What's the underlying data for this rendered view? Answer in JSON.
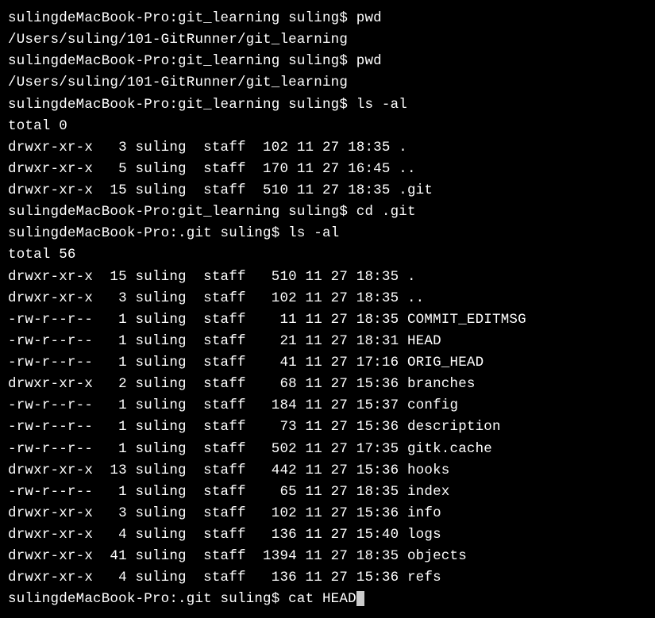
{
  "lines": [
    {
      "type": "prompt",
      "prompt": "sulingdeMacBook-Pro:git_learning suling$ ",
      "cmd": "pwd"
    },
    {
      "type": "output",
      "text": "/Users/suling/101-GitRunner/git_learning"
    },
    {
      "type": "prompt",
      "prompt": "sulingdeMacBook-Pro:git_learning suling$ ",
      "cmd": "pwd"
    },
    {
      "type": "output",
      "text": "/Users/suling/101-GitRunner/git_learning"
    },
    {
      "type": "prompt",
      "prompt": "sulingdeMacBook-Pro:git_learning suling$ ",
      "cmd": "ls -al"
    },
    {
      "type": "output",
      "text": "total 0"
    },
    {
      "type": "output",
      "text": "drwxr-xr-x   3 suling  staff  102 11 27 18:35 ."
    },
    {
      "type": "output",
      "text": "drwxr-xr-x   5 suling  staff  170 11 27 16:45 .."
    },
    {
      "type": "output",
      "text": "drwxr-xr-x  15 suling  staff  510 11 27 18:35 .git"
    },
    {
      "type": "prompt",
      "prompt": "sulingdeMacBook-Pro:git_learning suling$ ",
      "cmd": "cd .git"
    },
    {
      "type": "prompt",
      "prompt": "sulingdeMacBook-Pro:.git suling$ ",
      "cmd": "ls -al"
    },
    {
      "type": "output",
      "text": "total 56"
    },
    {
      "type": "output",
      "text": "drwxr-xr-x  15 suling  staff   510 11 27 18:35 ."
    },
    {
      "type": "output",
      "text": "drwxr-xr-x   3 suling  staff   102 11 27 18:35 .."
    },
    {
      "type": "output",
      "text": "-rw-r--r--   1 suling  staff    11 11 27 18:35 COMMIT_EDITMSG"
    },
    {
      "type": "output",
      "text": "-rw-r--r--   1 suling  staff    21 11 27 18:31 HEAD"
    },
    {
      "type": "output",
      "text": "-rw-r--r--   1 suling  staff    41 11 27 17:16 ORIG_HEAD"
    },
    {
      "type": "output",
      "text": "drwxr-xr-x   2 suling  staff    68 11 27 15:36 branches"
    },
    {
      "type": "output",
      "text": "-rw-r--r--   1 suling  staff   184 11 27 15:37 config"
    },
    {
      "type": "output",
      "text": "-rw-r--r--   1 suling  staff    73 11 27 15:36 description"
    },
    {
      "type": "output",
      "text": "-rw-r--r--   1 suling  staff   502 11 27 17:35 gitk.cache"
    },
    {
      "type": "output",
      "text": "drwxr-xr-x  13 suling  staff   442 11 27 15:36 hooks"
    },
    {
      "type": "output",
      "text": "-rw-r--r--   1 suling  staff    65 11 27 18:35 index"
    },
    {
      "type": "output",
      "text": "drwxr-xr-x   3 suling  staff   102 11 27 15:36 info"
    },
    {
      "type": "output",
      "text": "drwxr-xr-x   4 suling  staff   136 11 27 15:40 logs"
    },
    {
      "type": "output",
      "text": "drwxr-xr-x  41 suling  staff  1394 11 27 18:35 objects"
    },
    {
      "type": "output",
      "text": "drwxr-xr-x   4 suling  staff   136 11 27 15:36 refs"
    }
  ],
  "active_prompt": "sulingdeMacBook-Pro:.git suling$ ",
  "active_cmd": "cat HEAD"
}
